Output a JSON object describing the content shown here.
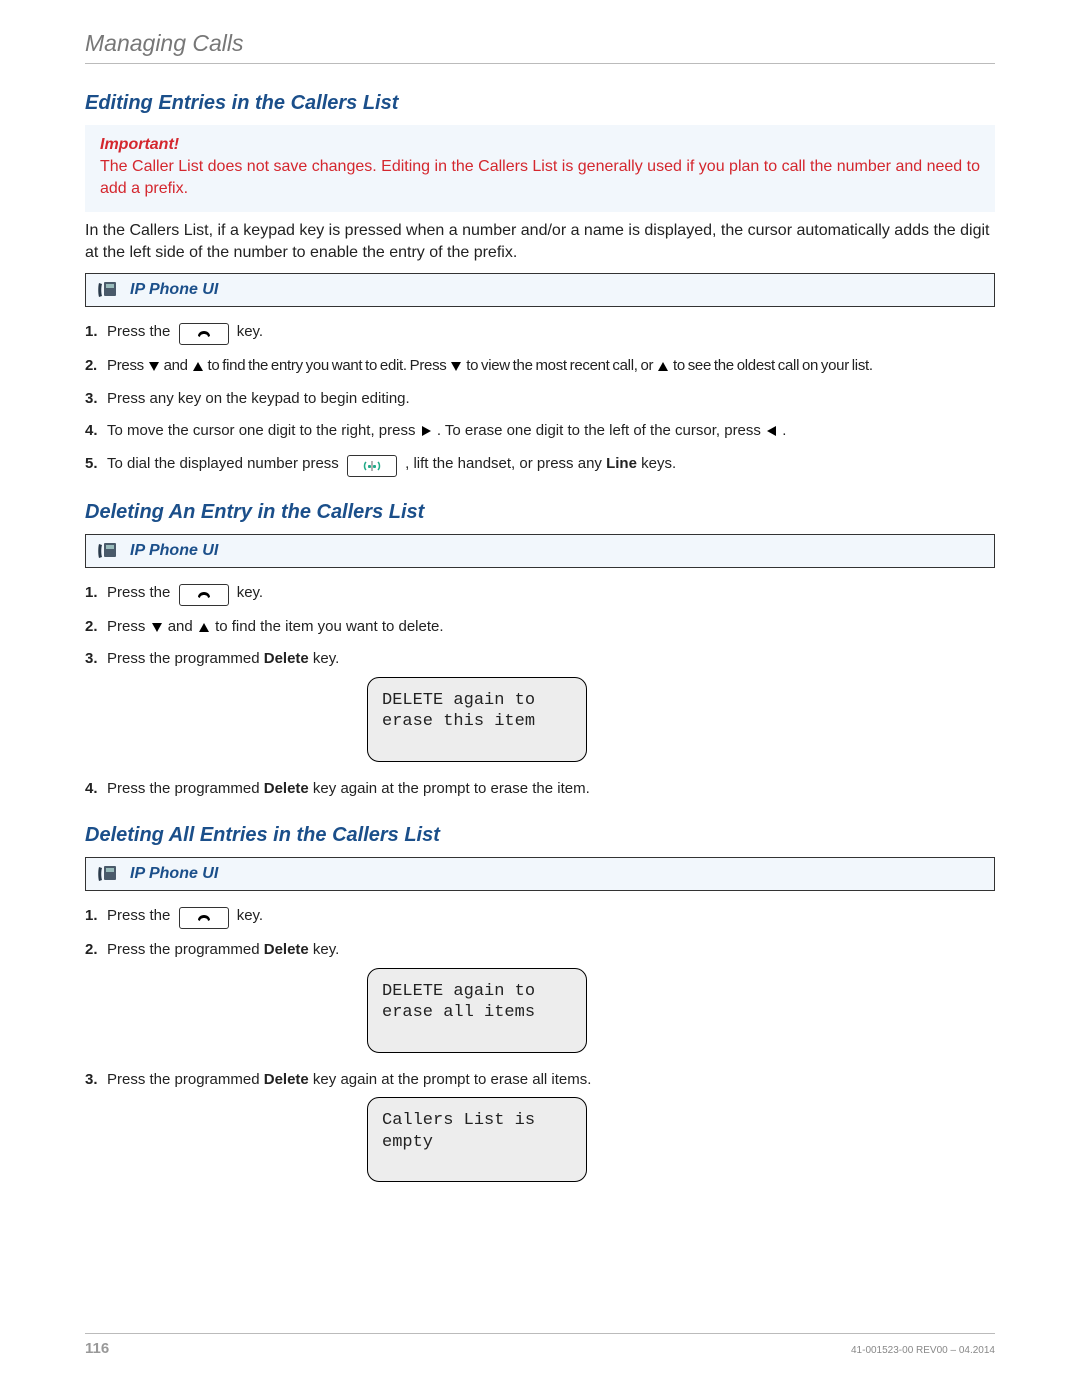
{
  "header": "Managing Calls",
  "section1": {
    "title": "Editing Entries in the Callers List",
    "important_label": "Important!",
    "important_text": "The Caller List does not save changes. Editing in the Callers List is generally used if you plan to call the number and need to add a prefix.",
    "body": "In the Callers List, if a keypad key is pressed when a number and/or a name is displayed, the cursor automatically adds the digit at the left side of the number to enable the entry of the prefix.",
    "ui_label": "IP Phone UI",
    "steps": {
      "s1a": "Press the ",
      "s1b": " key.",
      "s2a": "Press ",
      "s2b": " and ",
      "s2c": " to find the entry you want to edit. Press ",
      "s2d": " to view the most recent call, or ",
      "s2e": " to see the oldest call on your list.",
      "s3": "Press any key on the keypad to begin editing.",
      "s4a": "To move the cursor one digit to the right, press ",
      "s4b": ". To erase one digit to the left of the cursor, press ",
      "s4c": ".",
      "s5a": "To dial the displayed number press ",
      "s5b": ", lift the handset, or press any ",
      "s5c": "Line",
      "s5d": " keys."
    }
  },
  "section2": {
    "title": "Deleting An Entry in the Callers List",
    "ui_label": "IP Phone UI",
    "steps": {
      "s1a": "Press the ",
      "s1b": " key.",
      "s2a": "Press ",
      "s2b": " and ",
      "s2c": " to find the item you want to delete.",
      "s3a": "Press the programmed ",
      "s3b": "Delete",
      "s3c": " key.",
      "lcd1_l1": "DELETE again to",
      "lcd1_l2": "erase this item",
      "s4a": "Press the programmed ",
      "s4b": "Delete",
      "s4c": " key again at the prompt to erase the item."
    }
  },
  "section3": {
    "title": "Deleting All Entries in the Callers List",
    "ui_label": "IP Phone UI",
    "steps": {
      "s1a": "Press the ",
      "s1b": " key.",
      "s2a": "Press the programmed ",
      "s2b": "Delete",
      "s2c": " key.",
      "lcd1_l1": "DELETE again to",
      "lcd1_l2": "erase all items",
      "s3a": "Press the programmed ",
      "s3b": "Delete",
      "s3c": " key again at the prompt to erase all items.",
      "lcd2_l1": "Callers List is",
      "lcd2_l2": "empty"
    }
  },
  "footer": {
    "page": "116",
    "docid": "41-001523-00 REV00 – 04.2014"
  }
}
